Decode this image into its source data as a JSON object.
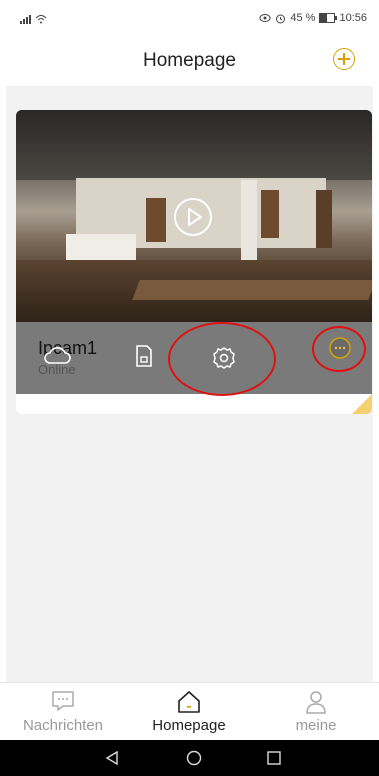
{
  "status_bar": {
    "battery_text": "45 %",
    "time": "10:56"
  },
  "header": {
    "title": "Homepage",
    "add_icon": "plus-circle-icon"
  },
  "camera": {
    "name": "Ipcam1",
    "status": "Online",
    "play_icon": "play-icon",
    "actions": [
      "cloud-icon",
      "sd-card-icon",
      "gear-icon",
      "more-icon"
    ]
  },
  "tabs": [
    {
      "label": "Nachrichten",
      "icon": "message-icon",
      "active": false
    },
    {
      "label": "Homepage",
      "icon": "home-icon",
      "active": true
    },
    {
      "label": "meine",
      "icon": "person-icon",
      "active": false
    }
  ],
  "nav": [
    "back-icon",
    "home-circle-icon",
    "recents-icon"
  ],
  "colors": {
    "accent": "#d4a100",
    "annotation": "#e01010",
    "inactive_tab": "#999999",
    "active_tab": "#222222"
  }
}
